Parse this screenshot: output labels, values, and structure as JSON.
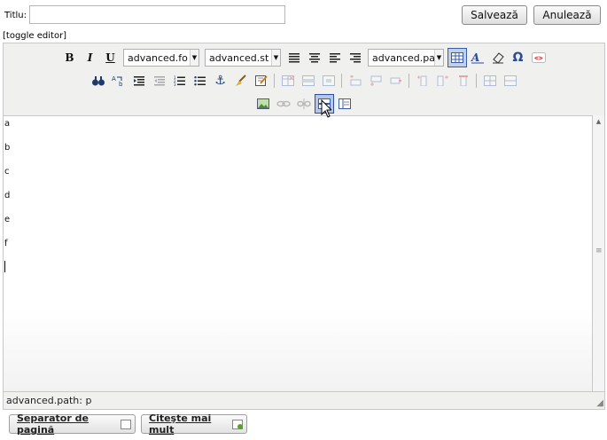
{
  "form": {
    "title_label": "Titlu:",
    "title_value": "",
    "save_label": "Salvează",
    "cancel_label": "Anulează",
    "toggle_editor": "[toggle editor]"
  },
  "toolbar": {
    "row1": {
      "bold": "B",
      "italic": "I",
      "underline": "U",
      "font_select": "advanced.fo",
      "style_select": "advanced.st",
      "paragraph_select": "advanced.pa",
      "special_char": "Ω"
    }
  },
  "content": {
    "lines": [
      "a",
      "b",
      "c",
      "d",
      "e",
      "f"
    ]
  },
  "status": {
    "path": "advanced.path: p"
  },
  "plugins": {
    "page_separator": "Separator de pagină",
    "read_more": "Citeşte mai mult"
  },
  "colors": {
    "toolbar_bg": "#f0f0ee",
    "active_border": "#3a5da8",
    "icon_blue": "#1d3a6b"
  }
}
